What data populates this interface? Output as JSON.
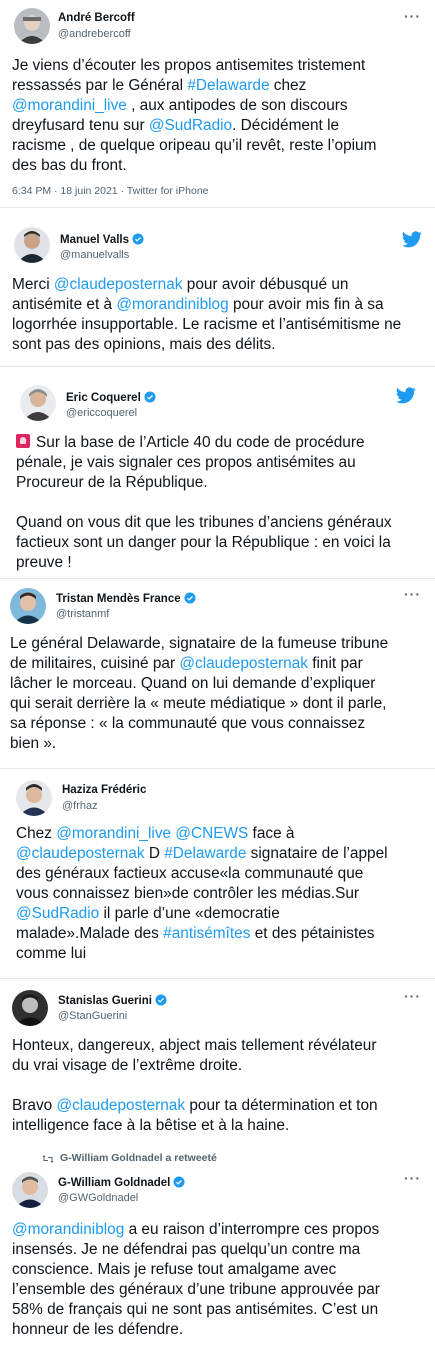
{
  "colors": {
    "link": "#1d9bf0",
    "verified": "#1d9bf0",
    "muted": "#536471",
    "twitter": "#1d9bf0"
  },
  "tweets": [
    {
      "name": "André Bercoff",
      "handle": "@andrebercoff",
      "verified": false,
      "text_lines": [
        [
          {
            "t": "Je viens d’écouter les propos antisemites tristement"
          }
        ],
        [
          {
            "t": "ressassés par le Général "
          },
          {
            "t": "#Delawarde",
            "link": true
          },
          {
            "t": " chez"
          }
        ],
        [
          {
            "t": "@morandini_live",
            "link": true
          },
          {
            "t": " , aux antipodes de son discours"
          }
        ],
        [
          {
            "t": "dreyfusard tenu sur "
          },
          {
            "t": "@SudRadio",
            "link": true
          },
          {
            "t": ". Décidément le"
          }
        ],
        [
          {
            "t": "racisme , de quelque oripeau qu’il revêt, reste l’opium"
          }
        ],
        [
          {
            "t": "des bas du front."
          }
        ]
      ],
      "meta": "6:34 PM · 18 juin 2021 · Twitter for iPhone"
    },
    {
      "name": "Manuel Valls",
      "handle": "@manuelvalls",
      "verified": true,
      "text_lines": [
        [
          {
            "t": "Merci "
          },
          {
            "t": "@claudeposternak",
            "link": true
          },
          {
            "t": " pour avoir débusqué un"
          }
        ],
        [
          {
            "t": "antisémite et à "
          },
          {
            "t": "@morandiniblog",
            "link": true
          },
          {
            "t": " pour avoir mis fin à sa"
          }
        ],
        [
          {
            "t": "logorrhée insupportable. Le racisme et l’antisémitisme ne"
          }
        ],
        [
          {
            "t": "sont pas des opinions, mais des délits."
          }
        ]
      ]
    },
    {
      "name": "Eric Coquerel",
      "handle": "@ericcoquerel",
      "verified": true,
      "text_lines": [
        [
          {
            "emoji": "siren"
          },
          {
            "t": "Sur la base de l’Article 40 du code de procédure"
          }
        ],
        [
          {
            "t": "pénale, je vais signaler ces propos antisémites au"
          }
        ],
        [
          {
            "t": "Procureur de la République."
          }
        ],
        [],
        [
          {
            "t": "Quand on vous dit que les tribunes d’anciens généraux"
          }
        ],
        [
          {
            "t": "factieux sont un danger pour la République : en voici la"
          }
        ],
        [
          {
            "t": "preuve !"
          }
        ]
      ]
    },
    {
      "name": "Tristan Mendès France",
      "handle": "@tristanmf",
      "verified": true,
      "text_lines": [
        [
          {
            "t": "Le général Delawarde, signataire de la fumeuse tribune"
          }
        ],
        [
          {
            "t": "de militaires, cuisiné par "
          },
          {
            "t": "@claudeposternak",
            "link": true
          },
          {
            "t": " finit par"
          }
        ],
        [
          {
            "t": "lâcher le morceau. Quand on lui demande d’expliquer"
          }
        ],
        [
          {
            "t": "qui serait derrière la « meute médiatique » dont il parle,"
          }
        ],
        [
          {
            "t": "sa réponse : « la communauté que vous connaissez"
          }
        ],
        [
          {
            "t": "bien »."
          }
        ]
      ]
    },
    {
      "name": "Haziza Frédéric",
      "handle": "@frhaz",
      "verified": false,
      "text_lines": [
        [
          {
            "t": "Chez "
          },
          {
            "t": "@morandini_live",
            "link": true
          },
          {
            "t": " "
          },
          {
            "t": "@CNEWS",
            "link": true
          },
          {
            "t": " face à"
          }
        ],
        [
          {
            "t": "@claudeposternak",
            "link": true
          },
          {
            "t": " D "
          },
          {
            "t": "#Delawarde",
            "link": true
          },
          {
            "t": " signataire de l’appel"
          }
        ],
        [
          {
            "t": "des généraux factieux accuse«la communauté que"
          }
        ],
        [
          {
            "t": "vous connaissez bien»de contrôler les médias.Sur"
          }
        ],
        [
          {
            "t": "@SudRadio",
            "link": true
          },
          {
            "t": " il parle d’une «democratie"
          }
        ],
        [
          {
            "t": "malade».Malade des "
          },
          {
            "t": "#antisémîtes",
            "link": true
          },
          {
            "t": " et des pétainistes"
          }
        ],
        [
          {
            "t": "comme lui"
          }
        ]
      ]
    },
    {
      "name": "Stanislas Guerini",
      "handle": "@StanGuerini",
      "verified": true,
      "text_lines": [
        [
          {
            "t": "Honteux, dangereux, abject mais tellement révélateur"
          }
        ],
        [
          {
            "t": "du vrai visage de l’extrême droite."
          }
        ],
        [],
        [
          {
            "t": "Bravo "
          },
          {
            "t": "@claudeposternak",
            "link": true
          },
          {
            "t": " pour ta détermination et ton"
          }
        ],
        [
          {
            "t": "intelligence face à la bêtise et à la haine."
          }
        ]
      ]
    },
    {
      "retweet_label": "G-William Goldnadel a retweeté",
      "name": "G-William Goldnadel",
      "handle": "@GWGoldnadel",
      "verified": true,
      "text_lines": [
        [
          {
            "t": "@morandiniblog",
            "link": true
          },
          {
            "t": " a eu raison d’interrompre ces propos"
          }
        ],
        [
          {
            "t": "insensés. Je ne défendrai pas quelqu’un contre ma"
          }
        ],
        [
          {
            "t": "conscience. Mais je refuse tout amalgame avec"
          }
        ],
        [
          {
            "t": "l’ensemble des généraux d’une tribune approuvée par"
          }
        ],
        [
          {
            "t": "58% de français qui ne sont pas antisémites. C’est un"
          }
        ],
        [
          {
            "t": "honneur de les défendre."
          }
        ]
      ]
    }
  ]
}
